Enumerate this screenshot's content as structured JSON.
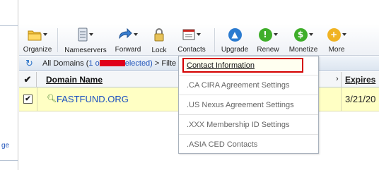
{
  "toolbar": {
    "buttons": [
      {
        "label": "Organize",
        "icon": "folder-icon"
      },
      {
        "label": "Nameservers",
        "icon": "server-icon"
      },
      {
        "label": "Forward",
        "icon": "forward-arrow-icon"
      },
      {
        "label": "Lock",
        "icon": "lock-icon"
      },
      {
        "label": "Contacts",
        "icon": "contacts-card-icon"
      },
      {
        "label": "Upgrade",
        "icon": "up-arrow-circle-icon"
      },
      {
        "label": "Renew",
        "icon": "renew-circle-icon"
      },
      {
        "label": "Monetize",
        "icon": "dollar-circle-icon"
      },
      {
        "label": "More",
        "icon": "plus-circle-icon"
      }
    ]
  },
  "breadcrumb": {
    "prefix": "All Domains (",
    "selected_start": "1 o",
    "selected_end": "elected)",
    "suffix": " > Filte"
  },
  "table": {
    "header_check": "✔",
    "domain_header": "Domain Name",
    "scroll_glyph": "›",
    "expires_header": "Expires",
    "rows": [
      {
        "checked": "✔",
        "domain": "FASTFUND.ORG",
        "expires": "3/21/20"
      }
    ]
  },
  "sidebar": {
    "link": "ge"
  },
  "contacts_menu": {
    "items": [
      "Contact Information",
      ".CA CIRA Agreement Settings",
      ".US Nexus Agreement Settings",
      ".XXX Membership ID Settings",
      ".ASIA CED Contacts"
    ]
  },
  "colors": {
    "selected_row": "#ffffc4",
    "link": "#1a4fc0",
    "highlight_border": "#d40000",
    "upgrade": "#2b7bd0",
    "renew": "#3fae2a",
    "monetize": "#3fae2a",
    "more": "#f0b323"
  }
}
